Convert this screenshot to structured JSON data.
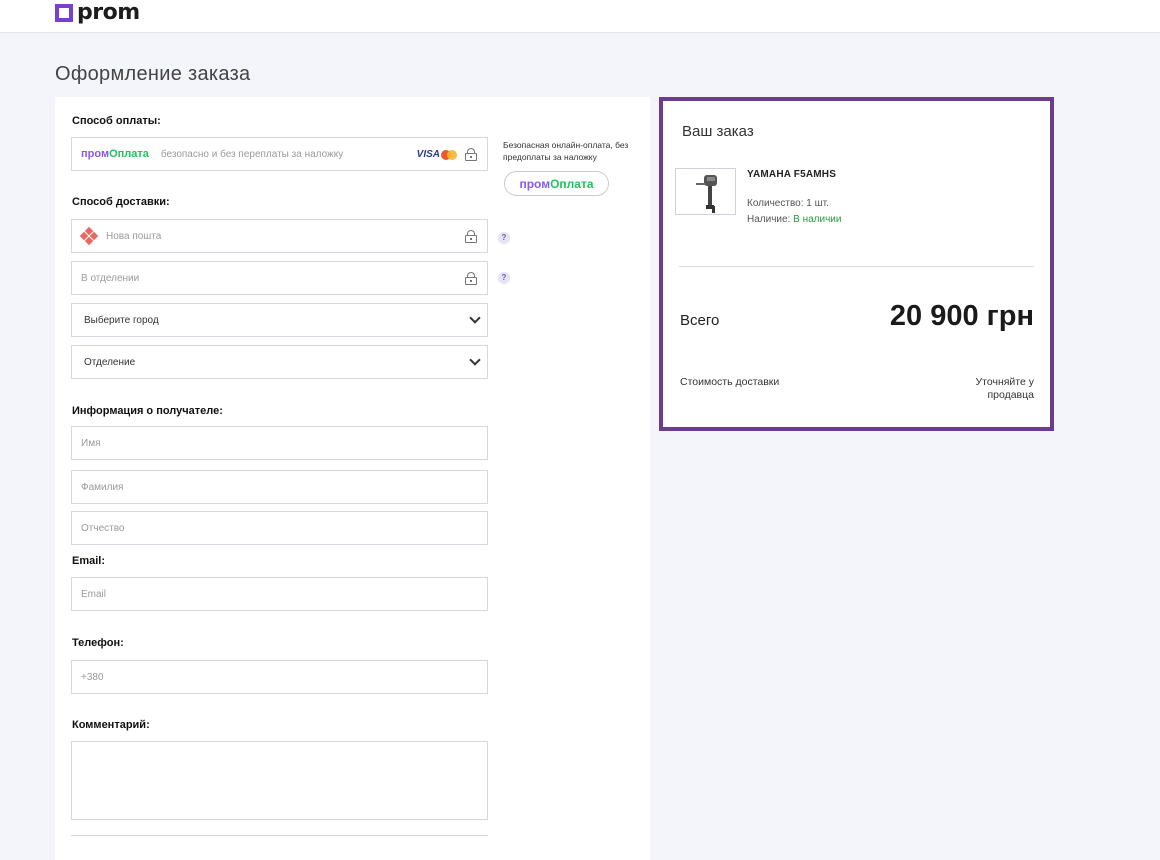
{
  "header": {
    "logo_text": "prom"
  },
  "page": {
    "title": "Оформление заказа"
  },
  "payment": {
    "label": "Способ оплаты:",
    "brand_part1": "пром",
    "brand_part2": "Оплата",
    "placeholder": "безопасно и без переплаты за наложку",
    "card_brand": "VISA",
    "side_note": "Безопасная онлайн-оплата, без предоплаты за наложку",
    "pill_part1": "пром",
    "pill_part2": "Оплата"
  },
  "delivery": {
    "label": "Способ доставки:",
    "carrier": "Нова пошта",
    "method": "В отделении",
    "city_select": "Выберите город",
    "branch_select": "Отделение",
    "help_glyph": "?"
  },
  "recipient": {
    "label": "Информация о получателе:",
    "first_name_placeholder": "Имя",
    "last_name_placeholder": "Фамилия",
    "middle_name_placeholder": "Отчество"
  },
  "email": {
    "label": "Email:",
    "placeholder": "Email"
  },
  "phone": {
    "label": "Телефон:",
    "placeholder": "+380"
  },
  "comment": {
    "label": "Комментарий:"
  },
  "order": {
    "title": "Ваш заказ",
    "product_name": "YAMAHA F5AMHS",
    "quantity": "Количество: 1 шт.",
    "availability_label": "Наличие:",
    "availability_value": "В наличии",
    "total_label": "Всего",
    "total_value": "20 900 грн",
    "shipping_label": "Стоимость доставки",
    "shipping_value": "Уточняйте у продавца"
  },
  "colors": {
    "brand_purple": "#7b3fcf",
    "order_border": "#6a3d8f",
    "available_green": "#2b9a3e",
    "promo_green": "#22c35e"
  }
}
